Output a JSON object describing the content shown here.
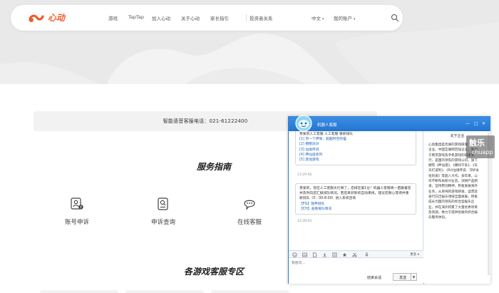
{
  "nav": {
    "logo_text": "心动",
    "items": [
      "游戏",
      "TapTap",
      "加入心动",
      "关于心动",
      "家长指引",
      "投资者关系"
    ],
    "language": "中文",
    "account": "我的账户"
  },
  "hotline": {
    "label": "智能语音客服电话：021-61222400"
  },
  "service_guide": {
    "title": "服务指南",
    "items": [
      {
        "label": "账号申诉",
        "icon": "account-appeal-icon"
      },
      {
        "label": "申诉查询",
        "icon": "appeal-query-icon"
      },
      {
        "label": "在线客服",
        "icon": "online-service-icon"
      }
    ]
  },
  "game_zone": {
    "title": "各游戏客服专区"
  },
  "chat": {
    "title": "机器人客服",
    "msg1": {
      "intro": "亲爱的人工客服 人工客服 重新排队",
      "links": [
        "[1] 另一个伊甸：超越时空的猫",
        "[2] 香肠派对",
        "[3] 仙境传说",
        "[4] 神仙道系列",
        "[5] 其他游戏"
      ],
      "time": "13:29:56"
    },
    "msg2": {
      "text": "亲爱的，现在人工客服太忙碌了，您排在第1位！机器人客服将一直跟着您并及时向您汇报排队情况，若您来到系统自动离线，建议您耐心等待并重新排队（0：00-8:00）进入系统咨询",
      "tag1": "【FG】",
      "link1": "放弃排队",
      "tag2": "【CH】",
      "link2": "查看排队情况",
      "time": "13:30:03"
    },
    "more_label": "更多",
    "input_placeholder": "我想问...",
    "end_label": "结束会话",
    "send_label": "发送",
    "side_title": "关于企业",
    "side_text": "心动集团是优质的游戏研发、发行企业，中国互联网百强企业，致力于网页游戏及手机游戏的研发发行，是国内领先的游戏公司，旗下拥有《神仙道》、《横扫千军》、《天天打波利》、《RO仙境传说：守护永恒的爱》等超人大作。多年来，公司不断布局新兴业态，深耕产品研发，坚持原创精神，积极发展海外业务，从单纯的游戏研发、运营及发行向泛娱乐领域全面发展，积极成长为国内领先的综合型娱乐企业，并在海外积累了大量优秀项目及资源，致力于提供优质的综合娱乐服务体验。"
  },
  "watermark": {
    "main": "触乐",
    "sub": "chuapp"
  },
  "colors": {
    "brand": "#f05a28",
    "chat_blue": "#2f7fd0",
    "link": "#2161b8"
  }
}
